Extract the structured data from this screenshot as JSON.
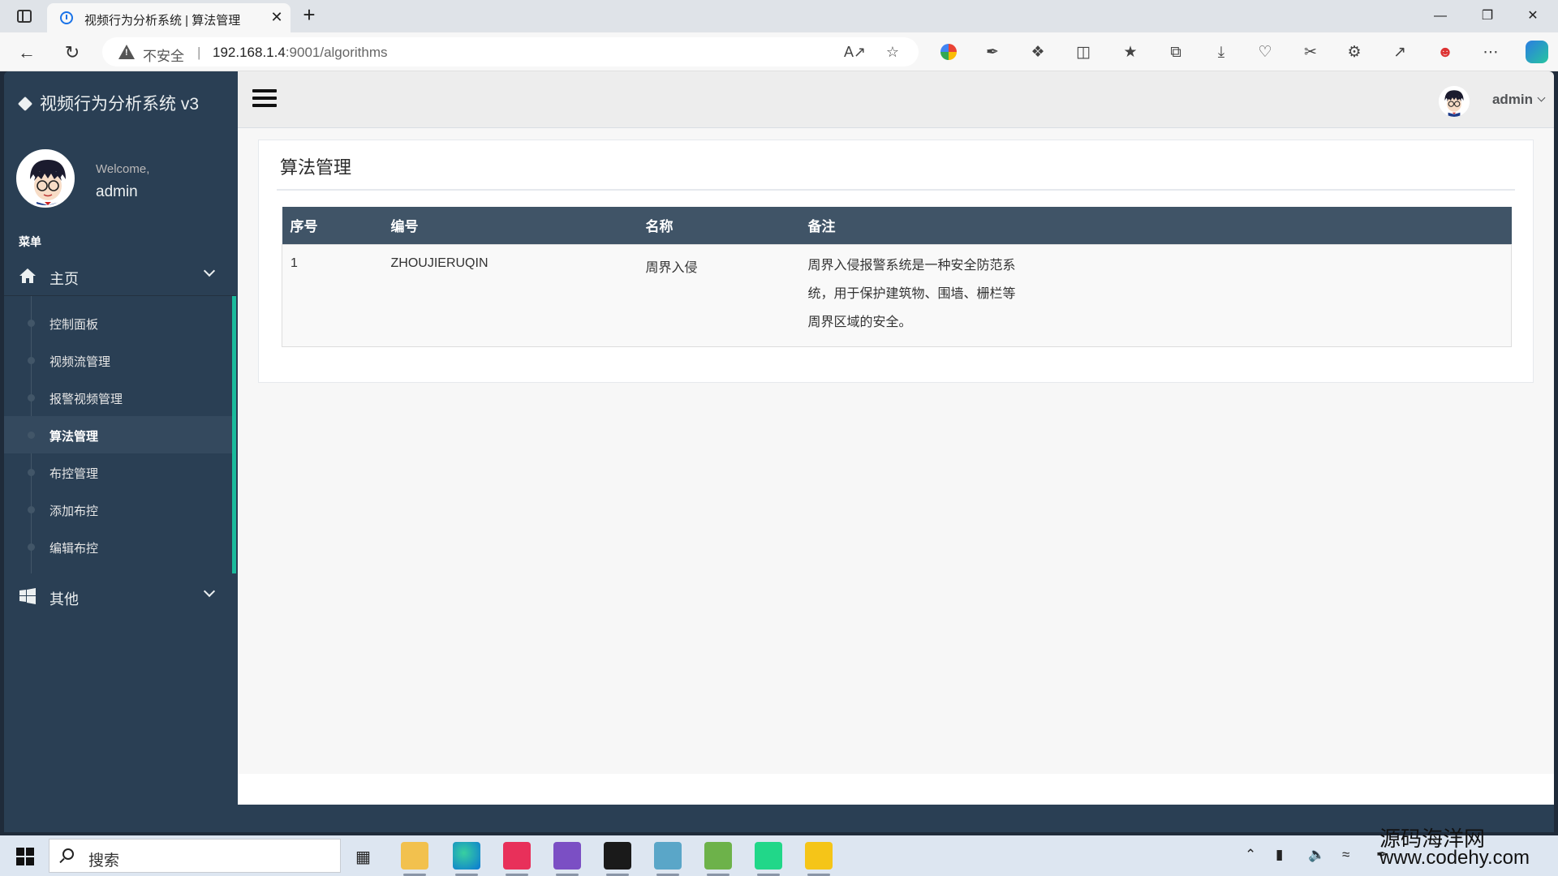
{
  "browser": {
    "tab_title": "视频行为分析系统 | 算法管理",
    "tab_close": "✕",
    "new_tab": "+",
    "insecure_label": "不安全",
    "separator": "|",
    "url_host": "192.168.1.4",
    "url_path": ":9001/algorithms"
  },
  "app": {
    "brand": "视频行为分析系统 v3",
    "welcome": "Welcome,",
    "username": "admin",
    "menu_heading": "菜单",
    "nav": {
      "home_label": "主页",
      "home_items": [
        {
          "label": "控制面板"
        },
        {
          "label": "视频流管理"
        },
        {
          "label": "报警视频管理"
        },
        {
          "label": "算法管理",
          "active": true
        },
        {
          "label": "布控管理"
        },
        {
          "label": "添加布控"
        },
        {
          "label": "编辑布控"
        }
      ],
      "other_label": "其他"
    },
    "topnav_user": "admin"
  },
  "page": {
    "title": "算法管理",
    "table": {
      "headers": [
        "序号",
        "编号",
        "名称",
        "备注"
      ],
      "rows": [
        {
          "index": "1",
          "code": "ZHOUJIERUQIN",
          "name": "周界入侵",
          "note": "周界入侵报警系统是一种安全防范系统，用于保护建筑物、围墙、栅栏等周界区域的安全。"
        }
      ]
    }
  },
  "taskbar": {
    "search_label": "搜索"
  },
  "watermark": {
    "line1": "源码海洋网",
    "line2": "www.codehy.com"
  },
  "colors": {
    "sidebar": "#2a3f54",
    "accent": "#1abb9c",
    "table_header": "#405467"
  }
}
